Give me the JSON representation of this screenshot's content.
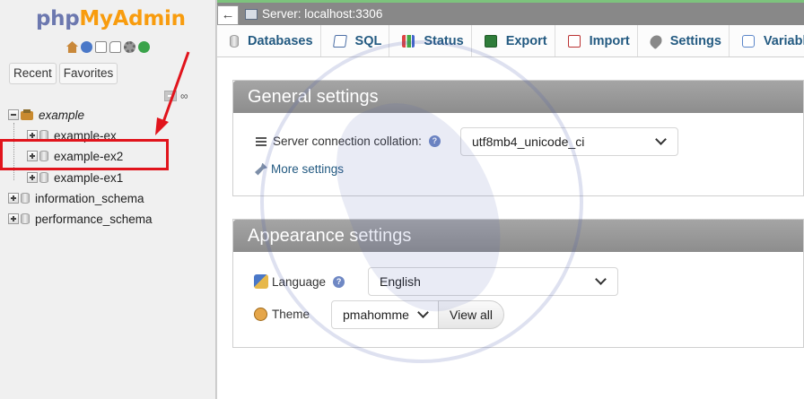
{
  "logo": {
    "php": "php",
    "admin": "MyAdmin"
  },
  "sidebar": {
    "tabs": [
      {
        "label": "Recent"
      },
      {
        "label": "Favorites"
      }
    ],
    "tree": [
      {
        "label": "example"
      },
      {
        "label": "example-ex"
      },
      {
        "label": "example-ex2"
      },
      {
        "label": "example-ex1"
      },
      {
        "label": "information_schema"
      },
      {
        "label": "performance_schema"
      }
    ],
    "highlight_color": "#e1141c"
  },
  "topbar": {
    "back": "←",
    "breadcrumb": "Server: localhost:3306"
  },
  "menu": [
    {
      "label": "Databases",
      "icon": "database-icon"
    },
    {
      "label": "SQL",
      "icon": "sql-icon"
    },
    {
      "label": "Status",
      "icon": "status-icon"
    },
    {
      "label": "Export",
      "icon": "export-icon"
    },
    {
      "label": "Import",
      "icon": "import-icon"
    },
    {
      "label": "Settings",
      "icon": "wrench-icon"
    },
    {
      "label": "Variables",
      "icon": "variables-icon"
    }
  ],
  "general": {
    "title": "General settings",
    "collation_label": "Server connection collation:",
    "collation_value": "utf8mb4_unicode_ci",
    "more_settings": "More settings"
  },
  "appearance": {
    "title": "Appearance settings",
    "language_label": "Language",
    "language_value": "English",
    "theme_label": "Theme",
    "theme_value": "pmahomme",
    "view_all": "View all"
  },
  "colors": {
    "accent_link": "#235a81",
    "panel_header": "#999999",
    "topbar": "#888888",
    "logo_php": "#6c78af",
    "logo_admin": "#f89c0e"
  }
}
